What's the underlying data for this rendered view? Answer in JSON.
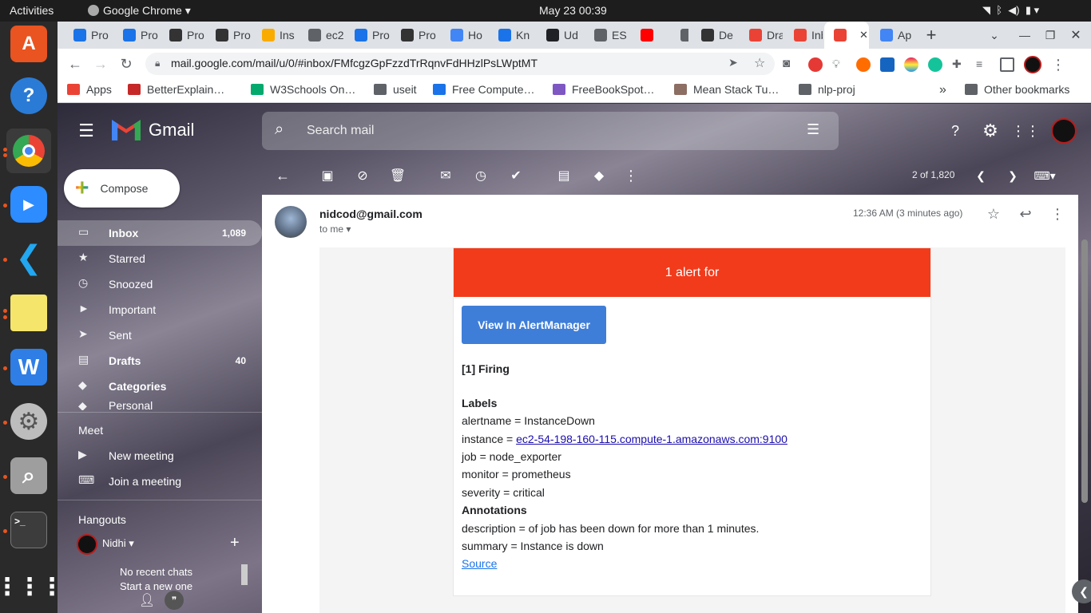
{
  "system": {
    "activities": "Activities",
    "app": "Google Chrome",
    "datetime": "May 23  00:39"
  },
  "tabs": [
    {
      "label": "Pro",
      "color": "#1a73e8"
    },
    {
      "label": "Pro",
      "color": "#1a73e8"
    },
    {
      "label": "Pro",
      "color": "#333"
    },
    {
      "label": "Pro",
      "color": "#333"
    },
    {
      "label": "Ins",
      "color": "#f9ab00"
    },
    {
      "label": "ec2",
      "color": "#5f6368"
    },
    {
      "label": "Pro",
      "color": "#1a73e8"
    },
    {
      "label": "Pro",
      "color": "#333"
    },
    {
      "label": "Ho",
      "color": "#4285f4"
    },
    {
      "label": "Kn",
      "color": "#1a73e8"
    },
    {
      "label": "Ud",
      "color": "#202124"
    },
    {
      "label": "ES",
      "color": "#5f6368"
    },
    {
      "label": "",
      "color": "#ff0000"
    },
    {
      "label": "",
      "color": "#5f6368"
    },
    {
      "label": "De",
      "color": "#333"
    },
    {
      "label": "Dra",
      "color": "#ea4335"
    },
    {
      "label": "Inb",
      "color": "#ea4335"
    },
    {
      "label": "",
      "color": "#ea4335"
    },
    {
      "label": "Ap",
      "color": "#4285f4"
    }
  ],
  "url": "mail.google.com/mail/u/0/#inbox/FMfcgzGpFzzdTrRqnvFdHHzlPsLWptMT",
  "bookmarks": [
    {
      "label": "Apps",
      "color": "#ea4335"
    },
    {
      "label": "BetterExplain…",
      "color": "#c62828"
    },
    {
      "label": "W3Schools On…",
      "color": "#04aa6d"
    },
    {
      "label": "useit",
      "color": "#5f6368"
    },
    {
      "label": "Free Compute…",
      "color": "#1a73e8"
    },
    {
      "label": "FreeBookSpot…",
      "color": "#7e57c2"
    },
    {
      "label": "Mean Stack Tu…",
      "color": "#8d6e63"
    },
    {
      "label": "nlp-proj",
      "color": "#5f6368"
    }
  ],
  "bookmarks_more": "»",
  "other_bookmarks": "Other bookmarks",
  "gmail": {
    "logo": "Gmail",
    "search_placeholder": "Search mail",
    "compose": "Compose",
    "nav": [
      {
        "label": "Inbox",
        "count": "1,089",
        "bold": true,
        "active": true
      },
      {
        "label": "Starred",
        "count": ""
      },
      {
        "label": "Snoozed",
        "count": ""
      },
      {
        "label": "Important",
        "count": ""
      },
      {
        "label": "Sent",
        "count": ""
      },
      {
        "label": "Drafts",
        "count": "40",
        "bold": true
      },
      {
        "label": "Categories",
        "count": "",
        "bold": true
      },
      {
        "label": "Personal",
        "count": ""
      }
    ],
    "meet": {
      "title": "Meet",
      "new_meeting": "New meeting",
      "join_meeting": "Join a meeting"
    },
    "hangouts": {
      "title": "Hangouts",
      "user": "Nidhi",
      "no_chats": "No recent chats",
      "start": "Start a new one"
    },
    "pagination": "2 of 1,820"
  },
  "email": {
    "sender": "nidcod@gmail.com",
    "to": "to me",
    "time": "12:36 AM (3 minutes ago)",
    "banner": "1 alert for",
    "banner_color": "#f23b1b",
    "button": "View In AlertManager",
    "firing": "[1] Firing",
    "labels_title": "Labels",
    "labels": [
      "alertname = InstanceDown",
      "instance = ",
      "job = node_exporter",
      "monitor = prometheus",
      "severity = critical"
    ],
    "instance_link": "ec2-54-198-160-115.compute-1.amazonaws.com:9100",
    "annotations_title": "Annotations",
    "annotations": [
      "description = of job has been down for more than 1 minutes.",
      "summary = Instance is down"
    ],
    "source": "Source"
  }
}
